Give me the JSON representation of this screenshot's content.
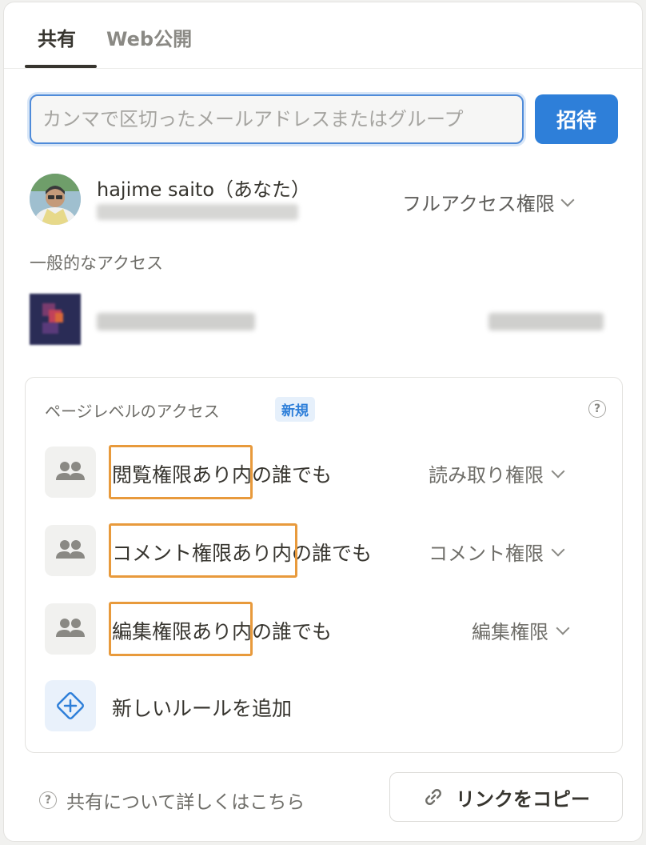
{
  "tabs": [
    {
      "label": "共有",
      "active": true
    },
    {
      "label": "Web公開",
      "active": false
    }
  ],
  "invite": {
    "placeholder": "カンマで区切ったメールアドレスまたはグループ",
    "button_label": "招待"
  },
  "owner": {
    "name": "hajime saito（あなた）",
    "permission": "フルアクセス権限"
  },
  "general_access": {
    "section_label": "一般的なアクセス"
  },
  "page_level": {
    "title": "ページレベルのアクセス",
    "badge": "新規",
    "rules": [
      {
        "group": "閲覧権限あり",
        "suffix": "内の誰でも",
        "permission": "読み取り権限"
      },
      {
        "group": "コメント権限あり",
        "suffix": "内の誰でも",
        "permission": "コメント権限"
      },
      {
        "group": "編集権限あり",
        "suffix": "内の誰でも",
        "permission": "編集権限"
      }
    ],
    "add_rule_label": "新しいルールを追加"
  },
  "footer": {
    "help_text": "共有について詳しくはこちら",
    "copy_link_label": "リンクをコピー"
  },
  "colors": {
    "accent": "#2e7fd9",
    "highlight": "#e89a3c"
  }
}
